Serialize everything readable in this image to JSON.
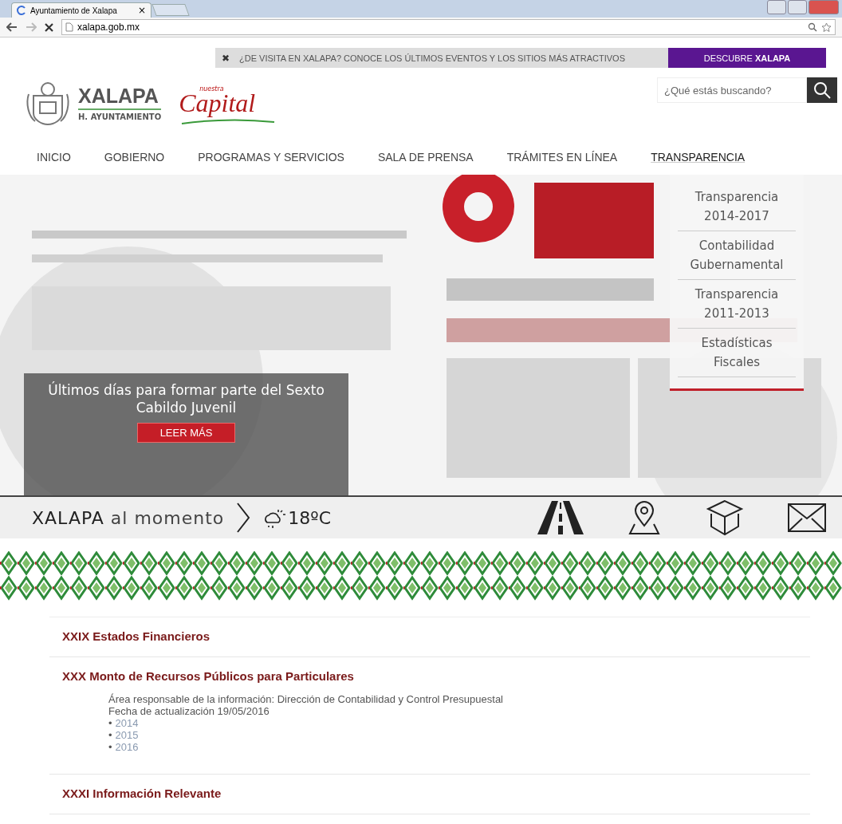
{
  "browser": {
    "tab": {
      "title": "Ayuntamiento de Xalapa",
      "close": "×"
    },
    "address": "xalapa.gob.mx"
  },
  "visit_bar": {
    "close": "✖",
    "message": "¿DE VISITA EN XALAPA? CONOCE LOS ÚLTIMOS EVENTOS Y LOS SITIOS MÁS ATRACTIVOS",
    "button": "DESCUBRE **XALAPA**"
  },
  "header": {
    "logo_title": "XALAPA",
    "logo_subtitle": "H. AYUNTAMIENTO",
    "slogan_small": "nuestra",
    "slogan": "Capital",
    "search": {
      "placeholder": "¿Qué estás buscando?"
    }
  },
  "nav": [
    {
      "label": "INICIO",
      "selected": false
    },
    {
      "label": "GOBIERNO",
      "selected": false
    },
    {
      "label": "PROGRAMAS Y SERVICIOS",
      "selected": false
    },
    {
      "label": "SALA DE PRENSA",
      "selected": false
    },
    {
      "label": "TRÁMITES EN LÍNEA",
      "selected": false
    },
    {
      "label": "TRANSPARENCIA",
      "selected": true
    }
  ],
  "dropdown": [
    {
      "label": "Transparencia 2014-2017"
    },
    {
      "label": "Contabilidad Gubernamental"
    },
    {
      "label": "Transparencia 2011-2013"
    },
    {
      "label": "Estadísticas Fiscales"
    }
  ],
  "slide": {
    "kind": "picture",
    "caption": "Últimos días para formar parte del Sexto Cabildo Juvenil",
    "button": "LEER MÁS"
  },
  "info_bar": {
    "city": "XALAPA",
    "tagline": "al momento",
    "temperature": "18ºC"
  },
  "sections": [
    {
      "title": "XXIX Estados Financieros"
    },
    {
      "title": "XXX Monto de Recursos Públicos para Particulares",
      "lines": [
        "Área responsable de la información: Dirección de Contabilidad y Control Presupuestal",
        "Fecha de actualización 19/05/2016"
      ],
      "links": [
        {
          "bullet": "•",
          "label": "2014"
        },
        {
          "bullet": "•",
          "label": "2015"
        },
        {
          "bullet": "•",
          "label": "2016"
        }
      ]
    },
    {
      "title": "XXXI Información Relevante"
    }
  ]
}
